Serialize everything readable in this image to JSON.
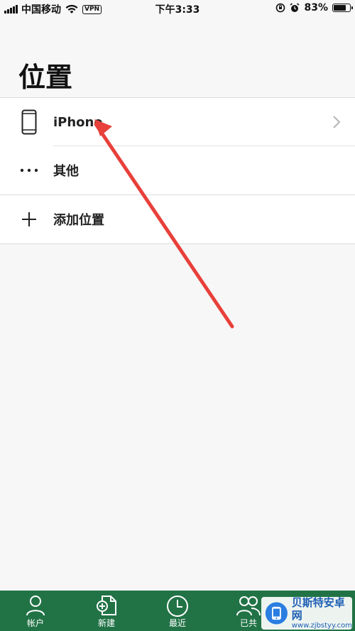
{
  "status_bar": {
    "carrier": "中国移动",
    "vpn": "VPN",
    "time": "下午3:33",
    "battery": "83%",
    "battery_level": 0.83
  },
  "page": {
    "title": "位置"
  },
  "locations": [
    {
      "label": "iPhone",
      "icon": "phone-icon",
      "chevron": true
    },
    {
      "label": "其他",
      "icon": "more-dots-icon",
      "chevron": false
    }
  ],
  "add_location": {
    "label": "添加位置",
    "icon": "plus-icon"
  },
  "tabbar": {
    "background": "#217346",
    "tabs": [
      {
        "label": "帐户",
        "icon": "account-icon"
      },
      {
        "label": "新建",
        "icon": "new-document-icon"
      },
      {
        "label": "最近",
        "icon": "clock-icon"
      },
      {
        "label": "已共",
        "icon": "shared-people-icon"
      }
    ]
  },
  "watermark": {
    "title": "贝斯特安卓网",
    "url": "www.zjbstyy.com"
  },
  "annotation": {
    "color": "#e8403a"
  }
}
